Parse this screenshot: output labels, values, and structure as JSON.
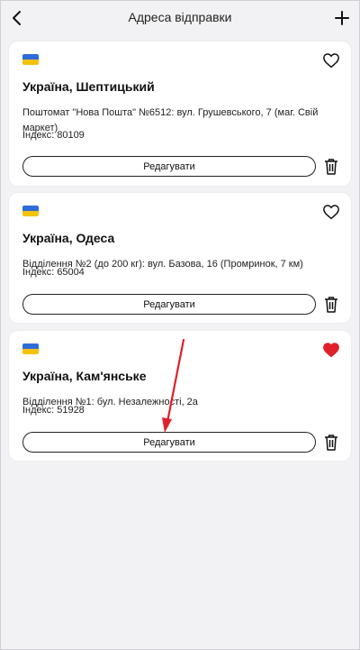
{
  "header": {
    "title": "Адреса відправки"
  },
  "icons": {
    "back": "chevron-left-icon",
    "add": "plus-icon",
    "flag": "ukraine-flag-icon",
    "favorite": "heart-icon",
    "delete": "trash-icon"
  },
  "colors": {
    "accent": "#e0202a",
    "flag_blue": "#2f6bd9",
    "flag_yellow": "#f4c20d"
  },
  "addresses": [
    {
      "city": "Україна, Шептицький",
      "address": "Поштомат \"Нова Пошта\" №6512: вул. Грушевського, 7 (маг. Свій маркет)",
      "index": "Індекс: 80109",
      "favorite": false,
      "edit_label": "Редагувати"
    },
    {
      "city": "Україна, Одеса",
      "address": "Відділення №2 (до 200 кг): вул. Базова, 16 (Промринок, 7 км)",
      "index": "Індекс: 65004",
      "favorite": false,
      "edit_label": "Редагувати"
    },
    {
      "city": "Україна, Кам'янське",
      "address": "Відділення №1: бул. Незалежності, 2а",
      "index": "Індекс: 51928",
      "favorite": true,
      "edit_label": "Редагувати"
    }
  ]
}
